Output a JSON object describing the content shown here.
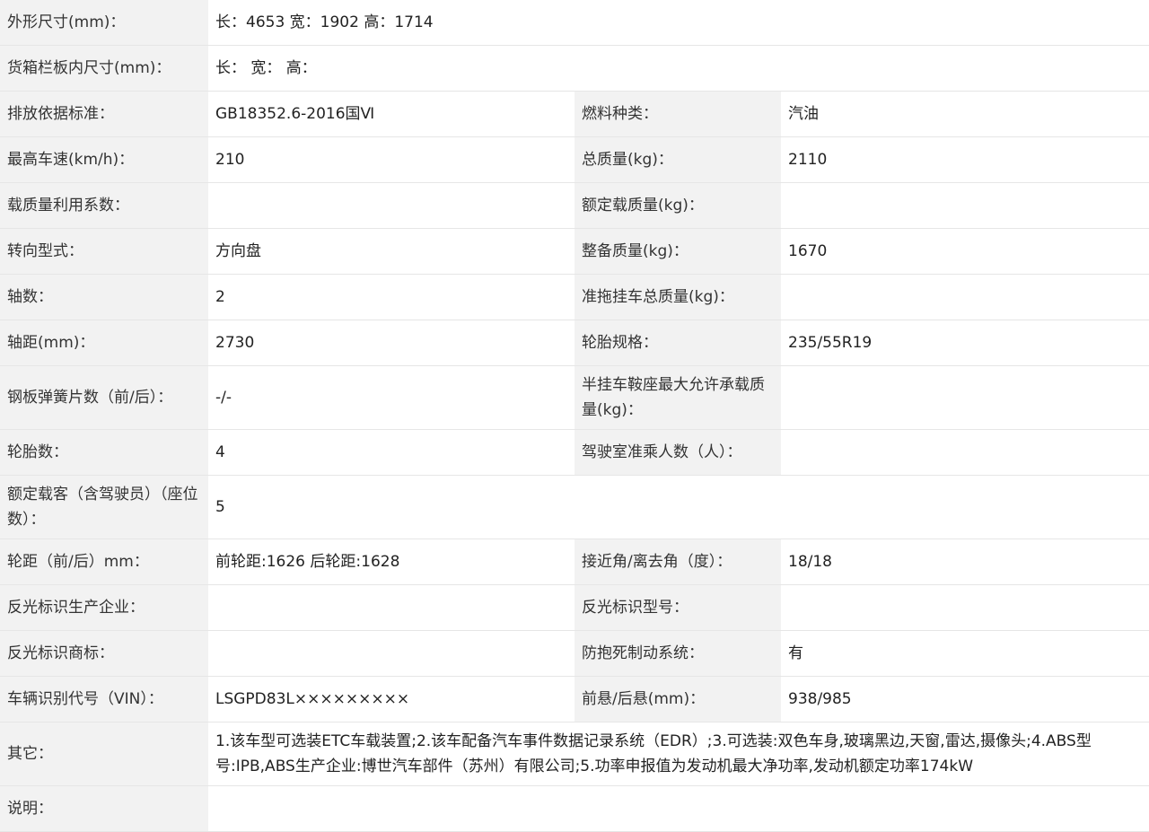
{
  "rows": [
    {
      "label": "外形尺寸(mm)：",
      "value": "长：4653 宽：1902 高：1714"
    },
    {
      "label": "货箱栏板内尺寸(mm)：",
      "value": "长：  宽：  高："
    },
    {
      "label": "排放依据标准：",
      "value": "GB18352.6-2016国Ⅵ",
      "label2": "燃料种类：",
      "value2": "汽油"
    },
    {
      "label": "最高车速(km/h)：",
      "value": "210",
      "label2": "总质量(kg)：",
      "value2": "2110"
    },
    {
      "label": "载质量利用系数：",
      "value": "",
      "label2": "额定载质量(kg)：",
      "value2": ""
    },
    {
      "label": "转向型式：",
      "value": "方向盘",
      "label2": "整备质量(kg)：",
      "value2": "1670"
    },
    {
      "label": "轴数：",
      "value": "2",
      "label2": "准拖挂车总质量(kg)：",
      "value2": ""
    },
    {
      "label": "轴距(mm)：",
      "value": "2730",
      "label2": "轮胎规格：",
      "value2": "235/55R19"
    },
    {
      "label": "钢板弹簧片数（前/后）：",
      "value": "-/-",
      "label2": "半挂车鞍座最大允许承载质量(kg)：",
      "value2": ""
    },
    {
      "label": "轮胎数：",
      "value": "4",
      "label2": "驾驶室准乘人数（人）：",
      "value2": ""
    },
    {
      "label": "额定载客（含驾驶员）（座位数）：",
      "value": "5"
    },
    {
      "label": "轮距（前/后）mm：",
      "value": "前轮距:1626 后轮距:1628",
      "label2": "接近角/离去角（度）：",
      "value2": "18/18"
    },
    {
      "label": "反光标识生产企业：",
      "value": "",
      "label2": "反光标识型号：",
      "value2": ""
    },
    {
      "label": "反光标识商标：",
      "value": "",
      "label2": "防抱死制动系统：",
      "value2": "有"
    },
    {
      "label": "车辆识别代号（VIN）：",
      "value": "LSGPD83L×××××××××",
      "label2": "前悬/后悬(mm)：",
      "value2": "938/985"
    },
    {
      "label": "其它：",
      "value": "1.该车型可选装ETC车载装置;2.该车配备汽车事件数据记录系统（EDR）;3.可选装:双色车身,玻璃黑边,天窗,雷达,摄像头;4.ABS型号:IPB,ABS生产企业:博世汽车部件（苏州）有限公司;5.功率申报值为发动机最大净功率,发动机额定功率174kW"
    },
    {
      "label": "说明：",
      "value": ""
    }
  ]
}
